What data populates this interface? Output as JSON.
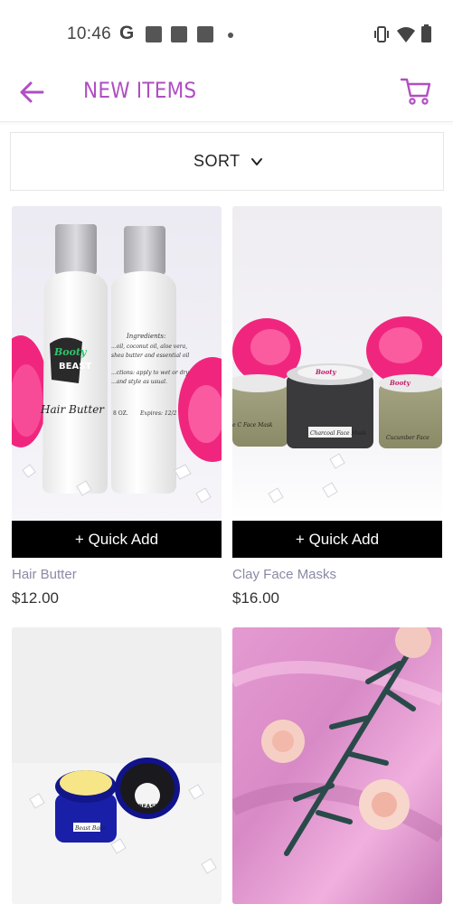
{
  "status_bar": {
    "time": "10:46",
    "g_label": "G"
  },
  "app_bar": {
    "title": "NEW ITEMS"
  },
  "sort": {
    "label": "SORT"
  },
  "products": [
    {
      "name": "Hair Butter",
      "price": "$12.00",
      "quick_add": "+ Quick Add",
      "img_text": {
        "brand": "Booty Beast",
        "product": "Hair Butter",
        "ingredients_title": "Ingredients:",
        "ingredients": "...oil, coconut oil, aloe vera, shea butter and essential oil...",
        "directions": "...ctions: apply to wet or dry ...and style as usual.",
        "size": "8 OZ.",
        "expires": "Expires: 12/2..."
      }
    },
    {
      "name": "Clay Face Masks",
      "price": "$16.00",
      "quick_add": "+ Quick Add",
      "img_text": {
        "brand": "Booty Beast",
        "center": "Charcoal Face Mask",
        "left": "...e C Face Mask",
        "right": "Cucumber Face..."
      }
    },
    {
      "name": "",
      "price": "",
      "img_text": {
        "label": "Beast Balm",
        "brand": "Beast"
      }
    },
    {
      "name": "",
      "price": ""
    }
  ],
  "colors": {
    "accent": "#b04fc2",
    "quick_add_bg": "#000000",
    "name_text": "#8a8aa5"
  },
  "icons": [
    "back-arrow-icon",
    "cart-icon",
    "chevron-down-icon",
    "vibrate-icon",
    "wifi-icon",
    "battery-icon"
  ]
}
